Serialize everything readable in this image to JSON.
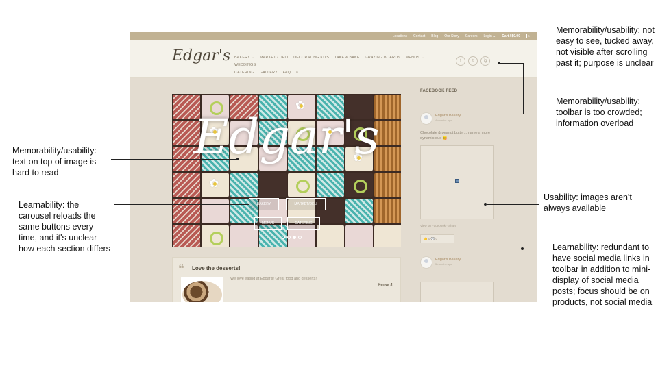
{
  "site": {
    "topbar_links": [
      "Locations",
      "Contact",
      "Blog",
      "Our Story",
      "Careers",
      "Login ⌄"
    ],
    "cart_label": "Cart / $0.00",
    "cart_count": "0",
    "logo": "Edgar's",
    "nav_row1": [
      "BAKERY ⌄",
      "MARKET / DELI",
      "DECORATING KITS",
      "TAKE & BAKE",
      "GRAZING BOARDS",
      "MENUS ⌄",
      "WEDDINGS"
    ],
    "nav_row2": [
      "CATERING",
      "GALLERY",
      "FAQ"
    ],
    "socials": [
      "f",
      "t",
      "ig"
    ],
    "hero": {
      "title": "Edgar's",
      "buttons": [
        "BAKERY",
        "MARKET/DELI",
        "MENUS",
        "CATERING"
      ]
    },
    "testimonial": {
      "title": "Love the desserts!",
      "text": "We love eating at Edgar's! Great food and desserts!",
      "author": "Kenya J."
    },
    "sidebar": {
      "title": "FACEBOOK FEED",
      "posts": [
        {
          "name": "Edgar's Bakery",
          "time": "4 months ago",
          "message": "Chocolate & peanut butter... name a more dynamic duo 😋",
          "links": "View on Facebook · Share",
          "actions": "👍 0  💬 0"
        },
        {
          "name": "Edgar's Bakery",
          "time": "5 months ago"
        }
      ]
    }
  },
  "annotations": [
    {
      "id": "topbar",
      "text": "Memorability/usability: not easy to see, tucked away, not visible after scrolling past it; purpose is unclear"
    },
    {
      "id": "toolbar",
      "text": "Memorability/usability: toolbar is too crowded; information overload"
    },
    {
      "id": "hero-text",
      "text": "Memorability/usability: text on top of image is hard to read"
    },
    {
      "id": "carousel",
      "text": "Learnability: the carousel reloads the same buttons every time, and it's unclear how each section differs"
    },
    {
      "id": "images",
      "text": "Usability: images aren't always available"
    },
    {
      "id": "social",
      "text": "Learnability: redundant to have social media links in toolbar in addition to mini-display of social media posts; focus should be on products, not social media"
    }
  ]
}
